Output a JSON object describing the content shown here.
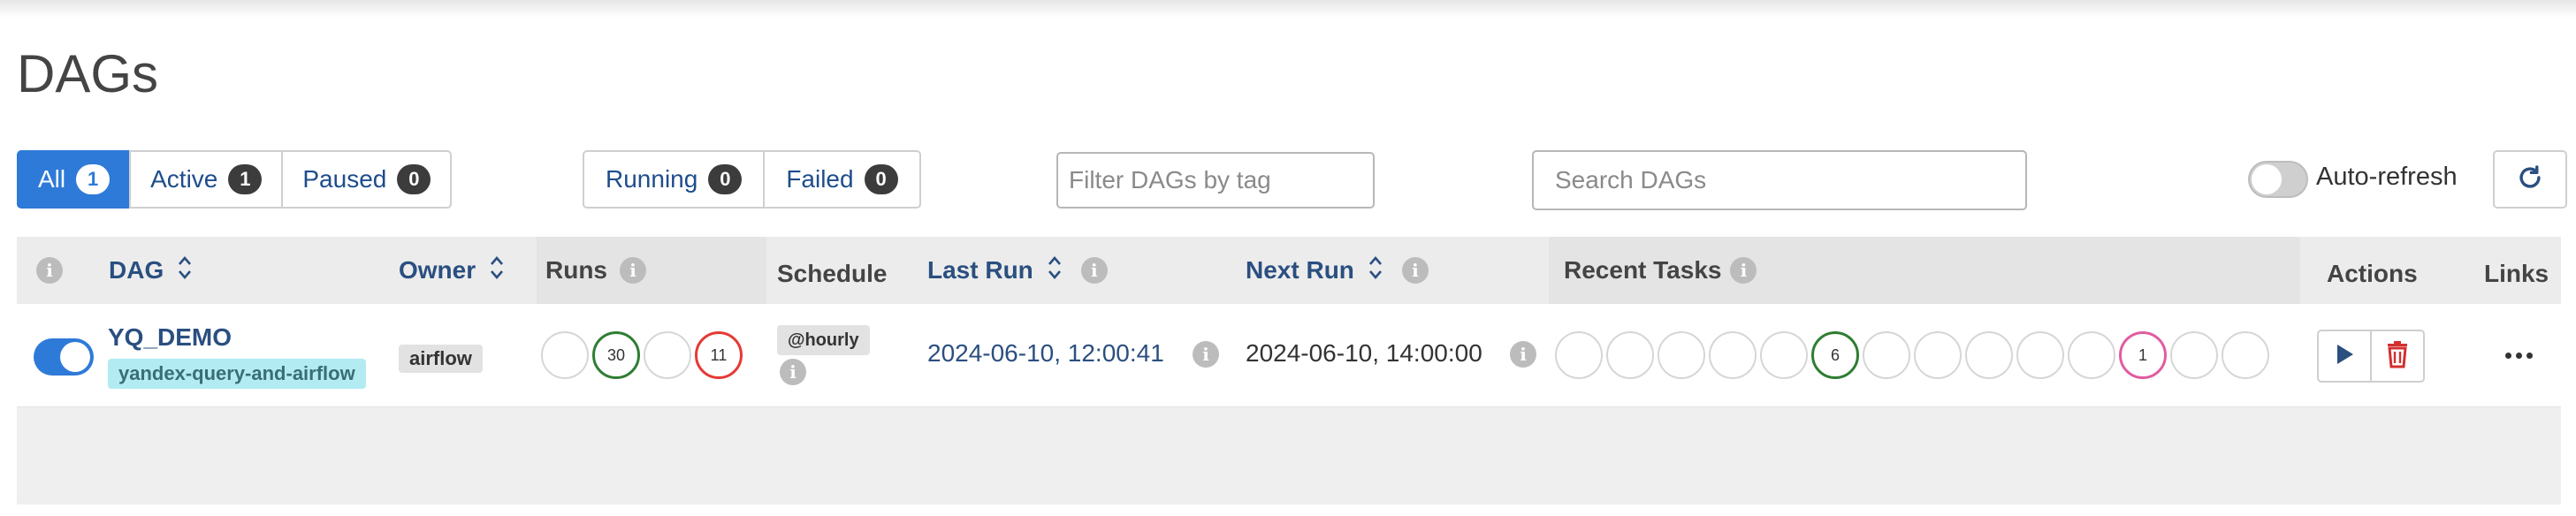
{
  "page": {
    "title": "DAGs"
  },
  "status_filters": [
    {
      "label": "All",
      "count": "1"
    },
    {
      "label": "Active",
      "count": "1"
    },
    {
      "label": "Paused",
      "count": "0"
    }
  ],
  "state_filters": [
    {
      "label": "Running",
      "count": "0"
    },
    {
      "label": "Failed",
      "count": "0"
    }
  ],
  "tag_filter": {
    "placeholder": "Filter DAGs by tag",
    "value": ""
  },
  "search": {
    "placeholder": "Search DAGs",
    "value": ""
  },
  "auto_refresh": {
    "label": "Auto-refresh",
    "enabled": false
  },
  "table": {
    "headers": {
      "dag": "DAG",
      "owner": "Owner",
      "runs": "Runs",
      "schedule": "Schedule",
      "last_run": "Last Run",
      "next_run": "Next Run",
      "recent_tasks": "Recent Tasks",
      "actions": "Actions",
      "links": "Links"
    },
    "rows": [
      {
        "paused": false,
        "dag_id": "YQ_DEMO",
        "tag": "yandex-query-and-airflow",
        "owner": "airflow",
        "runs": [
          {
            "count": "",
            "color": "#d6d6d6"
          },
          {
            "count": "30",
            "color": "#2e7d32"
          },
          {
            "count": "",
            "color": "#d6d6d6"
          },
          {
            "count": "11",
            "color": "#e53935"
          }
        ],
        "schedule": "@hourly",
        "last_run": "2024-06-10, 12:00:41",
        "next_run": "2024-06-10, 14:00:00",
        "recent_tasks": [
          {
            "count": "",
            "color": "#d6d6d6"
          },
          {
            "count": "",
            "color": "#d6d6d6"
          },
          {
            "count": "",
            "color": "#d6d6d6"
          },
          {
            "count": "",
            "color": "#d6d6d6"
          },
          {
            "count": "",
            "color": "#d6d6d6"
          },
          {
            "count": "6",
            "color": "#2e7d32"
          },
          {
            "count": "",
            "color": "#d6d6d6"
          },
          {
            "count": "",
            "color": "#d6d6d6"
          },
          {
            "count": "",
            "color": "#d6d6d6"
          },
          {
            "count": "",
            "color": "#d6d6d6"
          },
          {
            "count": "",
            "color": "#d6d6d6"
          },
          {
            "count": "1",
            "color": "#e05ca0"
          },
          {
            "count": "",
            "color": "#d6d6d6"
          },
          {
            "count": "",
            "color": "#d6d6d6"
          }
        ]
      }
    ]
  },
  "icons": {
    "info": "info-icon",
    "sort": "sort-icon",
    "refresh": "refresh-icon",
    "play": "play-icon",
    "delete": "trash-icon",
    "more": "more-icon"
  },
  "colors": {
    "accent": "#2e7ad8",
    "link": "#2a4f80",
    "success": "#2e7d32",
    "failed": "#e53935",
    "up_for_retry": "#e05ca0"
  }
}
